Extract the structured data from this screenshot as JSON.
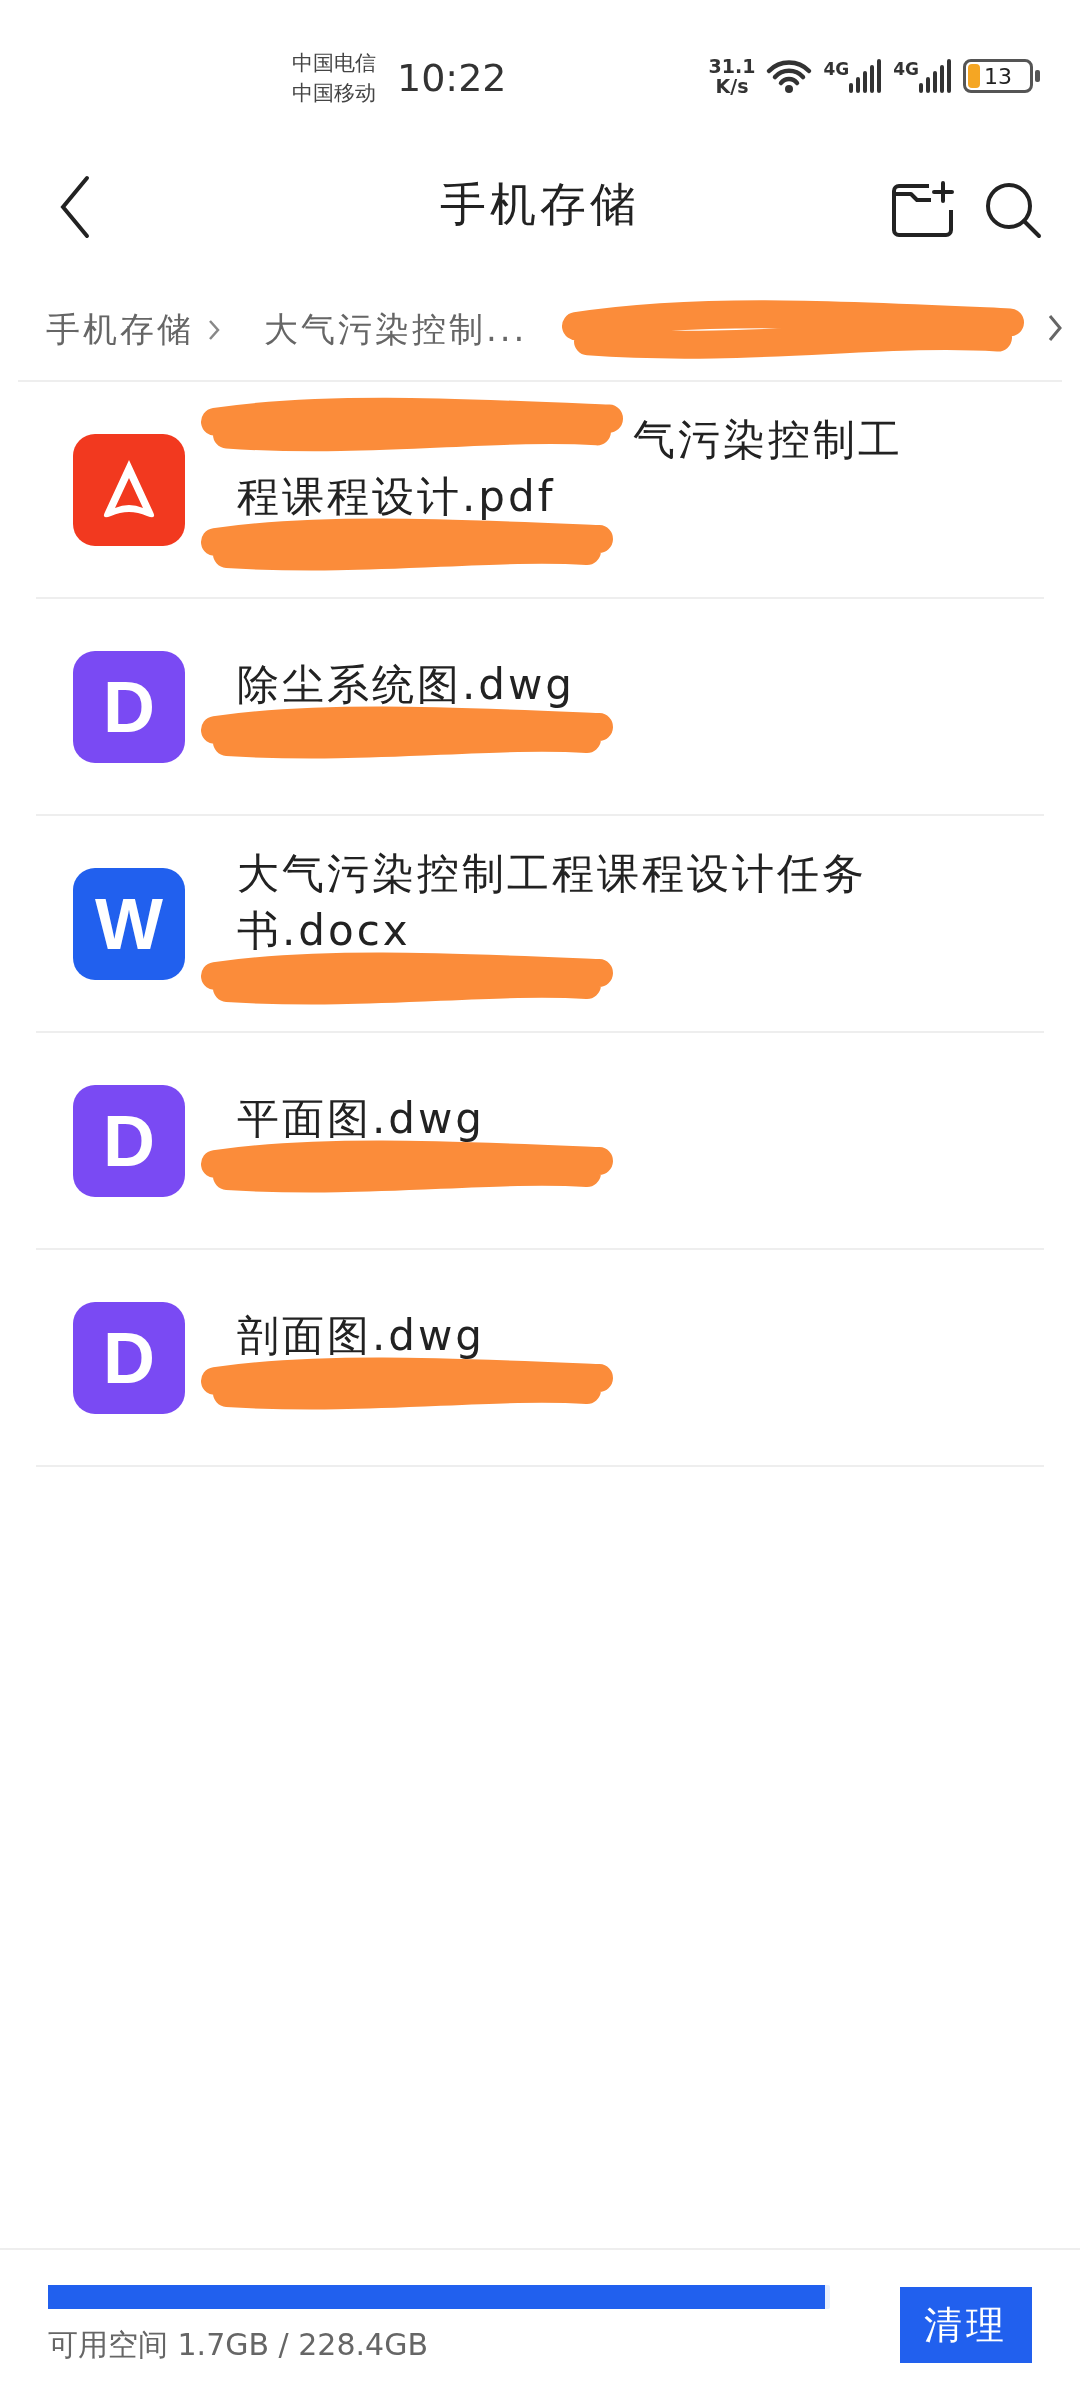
{
  "status_bar": {
    "carriers": [
      "中国电信",
      "中国移动"
    ],
    "time": "10:22",
    "net_speed": "31.1",
    "net_unit": "K/s",
    "networks": [
      "4G",
      "4G"
    ],
    "battery": "13"
  },
  "title_bar": {
    "title": "手机存储"
  },
  "breadcrumb": {
    "items": [
      "手机存储",
      "大气污染控制..."
    ],
    "redacted": true
  },
  "files": [
    {
      "kind": "pdf",
      "name": "气污染控制工程课程设计.pdf",
      "name_redacted": true,
      "meta_redacted": true
    },
    {
      "kind": "dwg",
      "badge": "D",
      "name": "除尘系统图.dwg",
      "name_redacted": false,
      "meta_redacted": true
    },
    {
      "kind": "docx",
      "badge": "W",
      "name": "大气污染控制工程课程设计任务书.docx",
      "name_redacted": false,
      "meta_redacted": true
    },
    {
      "kind": "dwg",
      "badge": "D",
      "name": "平面图.dwg",
      "name_redacted": false,
      "meta_redacted": true
    },
    {
      "kind": "dwg",
      "badge": "D",
      "name": "剖面图.dwg",
      "name_redacted": false,
      "meta_redacted": true
    }
  ],
  "storage": {
    "level": 0.993,
    "label": "可用空间 1.7GB / 228.4GB",
    "button": "清理"
  }
}
